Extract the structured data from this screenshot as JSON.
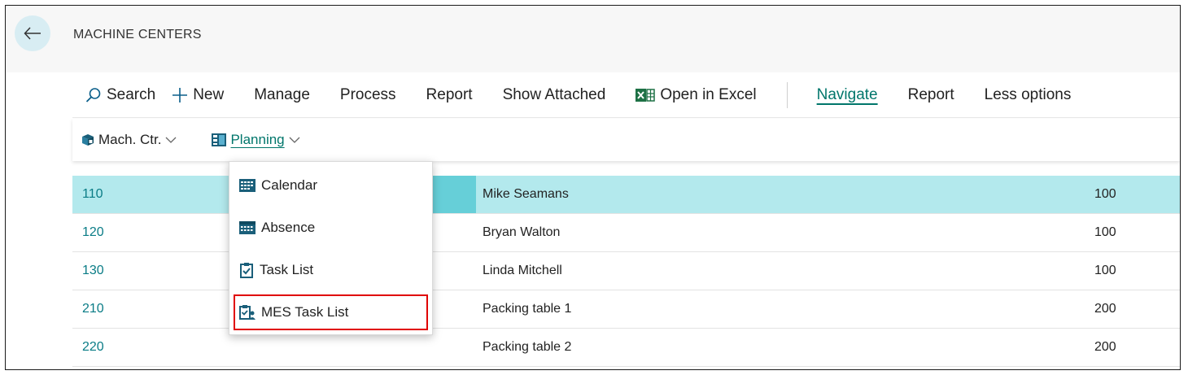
{
  "page": {
    "title": "MACHINE CENTERS",
    "back_label": "Back"
  },
  "actionbar": {
    "search": "Search",
    "new": "New",
    "manage": "Manage",
    "process": "Process",
    "report": "Report",
    "show_attached": "Show Attached",
    "open_in_excel": "Open in Excel",
    "navigate": "Navigate",
    "report2": "Report",
    "less_options": "Less options"
  },
  "subbar": {
    "mach_ctr": "Mach. Ctr.",
    "planning": "Planning"
  },
  "dropdown": {
    "items": [
      {
        "label": "Calendar",
        "icon": "calendar-icon"
      },
      {
        "label": "Absence",
        "icon": "absence-calendar-icon"
      },
      {
        "label": "Task List",
        "icon": "clipboard-check-icon"
      },
      {
        "label": "MES Task List",
        "icon": "mes-task-list-icon",
        "highlighted": true
      }
    ]
  },
  "rows": [
    {
      "no": "110",
      "name": "Mike Seamans",
      "value": "100",
      "selected": true
    },
    {
      "no": "120",
      "name": "Bryan Walton",
      "value": "100"
    },
    {
      "no": "130",
      "name": "Linda Mitchell",
      "value": "100"
    },
    {
      "no": "210",
      "name": "Packing table 1",
      "value": "200"
    },
    {
      "no": "220",
      "name": "Packing table 2",
      "value": "200"
    }
  ],
  "colors": {
    "accent": "#00766b",
    "link": "#0a7c86",
    "selected_row": "#b3e9ed",
    "highlight_border": "#e00000",
    "excel_green": "#1e7145"
  }
}
